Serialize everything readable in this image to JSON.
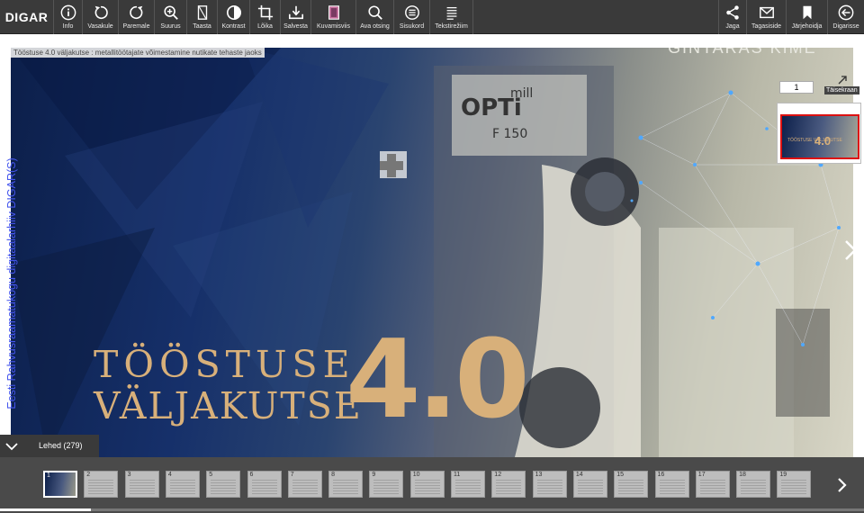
{
  "app": {
    "brand": "DIGAR"
  },
  "toolbar": {
    "left": [
      {
        "label": "Info",
        "icon": "info-icon"
      },
      {
        "label": "Vasakule",
        "icon": "rotate-left-icon"
      },
      {
        "label": "Paremale",
        "icon": "rotate-right-icon"
      },
      {
        "label": "Suurus",
        "icon": "zoom-in-icon"
      },
      {
        "label": "Taasta",
        "icon": "restore-icon"
      },
      {
        "label": "Kontrast",
        "icon": "contrast-icon"
      },
      {
        "label": "Lõika",
        "icon": "crop-icon"
      },
      {
        "label": "Salvesta",
        "icon": "download-icon"
      },
      {
        "label": "Kuvamisviis",
        "icon": "view-mode-icon"
      },
      {
        "label": "Ava otsing",
        "icon": "search-icon"
      },
      {
        "label": "Sisukord",
        "icon": "contents-icon"
      },
      {
        "label": "Tekstirežiim",
        "icon": "text-mode-icon"
      }
    ],
    "right": [
      {
        "label": "Jaga",
        "icon": "share-icon"
      },
      {
        "label": "Tagasiside",
        "icon": "mail-icon"
      },
      {
        "label": "Järjehoidja",
        "icon": "bookmark-icon"
      },
      {
        "label": "Digarisse",
        "icon": "back-icon"
      }
    ]
  },
  "document": {
    "title": "Tööstuse 4.0 väljakutse : metallitöötajate võimestamine nutikate tehaste jaoks",
    "watermark": "Eesti Rahvusraamatukogu digitaalarhiiv DIGAR(S)",
    "cover_line1": "TÖÖSTUSE",
    "cover_line2": "VÄLJAKUTSE",
    "cover_number": "4.0",
    "author_top": "GINTARAS  KIME",
    "current_page": "1",
    "fullscreen_label": "Täisekraan",
    "mini_text": "TÖÖSTUSE VÄLJAKUTSE",
    "mini_number": "4.0"
  },
  "pages_panel": {
    "label": "Lehed (279)",
    "thumbnails": [
      "1",
      "2",
      "3",
      "4",
      "5",
      "6",
      "7",
      "8",
      "9",
      "10",
      "11",
      "12",
      "13",
      "14",
      "15",
      "16",
      "17",
      "18",
      "19"
    ],
    "active_index": 0,
    "scroll_progress": 0.105
  },
  "colors": {
    "toolbar_bg": "#3a3a3a",
    "accent_gold": "#d8b07a",
    "watermark": "#4455ee",
    "highlight_red": "#dd1111"
  }
}
